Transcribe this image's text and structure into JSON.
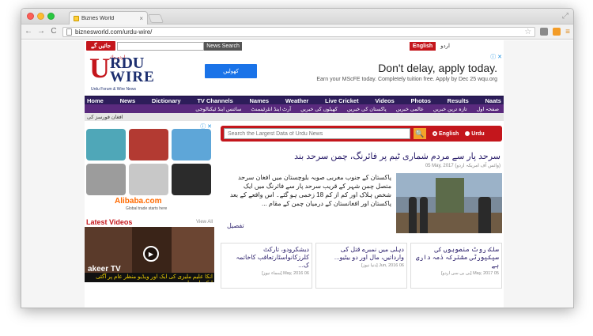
{
  "browser": {
    "tab_title": "Biznes World",
    "tab_close": "×",
    "url": "biznesworld.com/urdu-wire/",
    "back": "←",
    "forward": "→",
    "reload": "C",
    "star": "☆",
    "menu": "≡",
    "resize": "⤢"
  },
  "topbar": {
    "urdu_btn": "جائیں گے",
    "search_btn": "News Search",
    "lang_en": "English",
    "lang_ur": "اردو"
  },
  "logo": {
    "u": "U",
    "rdu": "RDU",
    "wire": "WIRE",
    "urdu_mark": "اردو وائر",
    "tagline": "Urdu Forum & Wire News"
  },
  "ad": {
    "badge": "ⓘ ✕",
    "button": "کھولیں",
    "headline": "Don't delay, apply today.",
    "sub": "Earn your MScFE today. Completely tuition free. Apply by Dec 25 wqu.org"
  },
  "nav_main": [
    "Home",
    "News",
    "Dictionary",
    "TV Channels",
    "Names",
    "Weather",
    "Live Cricket",
    "Videos",
    "Photos",
    "Results",
    "Naats"
  ],
  "nav_urdu": [
    "صفحہ اول",
    "تازہ ترین خبریں",
    "عالمی خبریں",
    "پاکستان کی خبریں",
    "کھیلوں کی خبریں",
    "آرٹ اینڈ انٹرٹینمنٹ",
    "سائنس اینڈ ٹیکنالوجی"
  ],
  "ticker": "افغان فورسز کی",
  "sidebar": {
    "ad_close": "ⓘ ✕",
    "alibaba": "Alibaba.com",
    "alibaba_tag": "Global trade starts here",
    "latest_title": "Latest Videos",
    "view_all": "View All",
    "video_brand": "akeer TV",
    "video_caption": "انکا علیم ملیزی کی ایک اور ویڈیو منظر عام پر آگئی لیکن اس بار"
  },
  "search": {
    "placeholder": "Search the Largest Data of Urdu News",
    "go": "🔍",
    "opt_en": "English",
    "opt_ur": "Urdu"
  },
  "story": {
    "headline": "سرحد پار سے مردم شماری ٹیم پر فائرنگ، چمن سرحد بند",
    "meta": "05 May, 2017 (وائس آف امریکہ اردو)",
    "text": "پاکستان کے جنوب مغربی صوبہ بلوچستان میں افغان سرحد متصل چمن شہر کے قریب سرحد پار سے فائرنگ میں ایک شخص ہلاک اور کم از کم 18 زخمی ہو گئے۔ اس واقعے کے بعد پاکستان اور افغانستان کے درمیان چمن کے مقام ...",
    "more": "تفصیل"
  },
  "cards": [
    {
      "title": "سلک روٹ منصوبوں کی سیکیورٹی مشترکہ ذمہ داری ہے",
      "meta": "05 May, 2017 [بی بی سی اردو]"
    },
    {
      "title": "دہلی میں نمبرے قتل کی وارداتیں، مال اور دو بیٹیو...",
      "meta": "06 Jun, 2016 [دنیا نیوز]"
    },
    {
      "title": "دیشکرودو، تارکٹ کلرزکانواسٹارتعاقب کاخاتمہ ک...",
      "meta": "06 May, 2016 [سماء نیوز]"
    }
  ]
}
